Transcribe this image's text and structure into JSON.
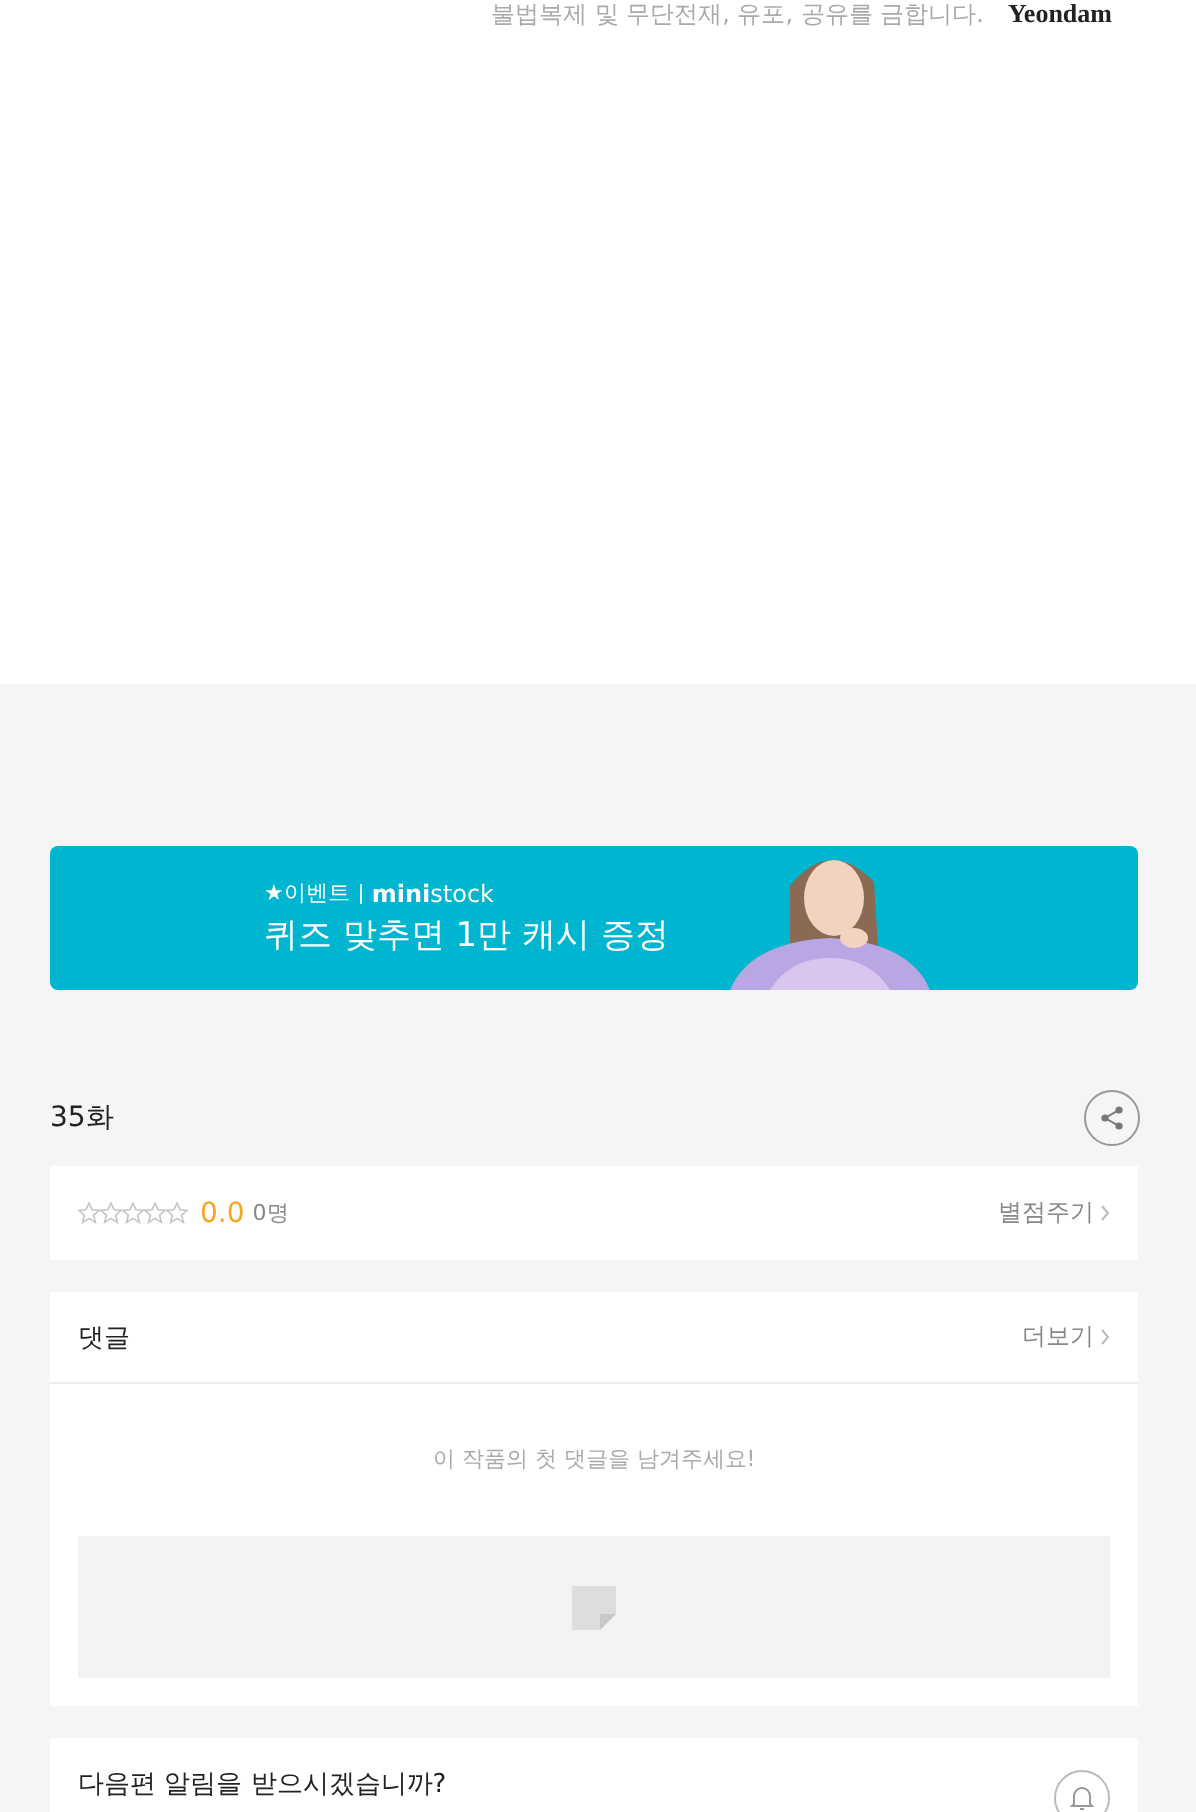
{
  "notice": {
    "text": "불법복제 및 무단전재, 유포, 공유를 금합니다.",
    "logo": "Yeondam"
  },
  "banner": {
    "kind": "picture",
    "event_label": "★이벤트",
    "brand": "**mini**stock",
    "headline": "퀴즈 맞추면 1만 캐시 증정"
  },
  "episode": {
    "title": "35화"
  },
  "rating": {
    "stars": 0,
    "score": "0.0",
    "count": "0명",
    "action": "별점주기"
  },
  "comments": {
    "title": "댓글",
    "more": "더보기",
    "empty_message": "이 작품의 첫 댓글을 남겨주세요!"
  },
  "notification": {
    "question": "다음편 알림을 받으시겠습니까?"
  }
}
